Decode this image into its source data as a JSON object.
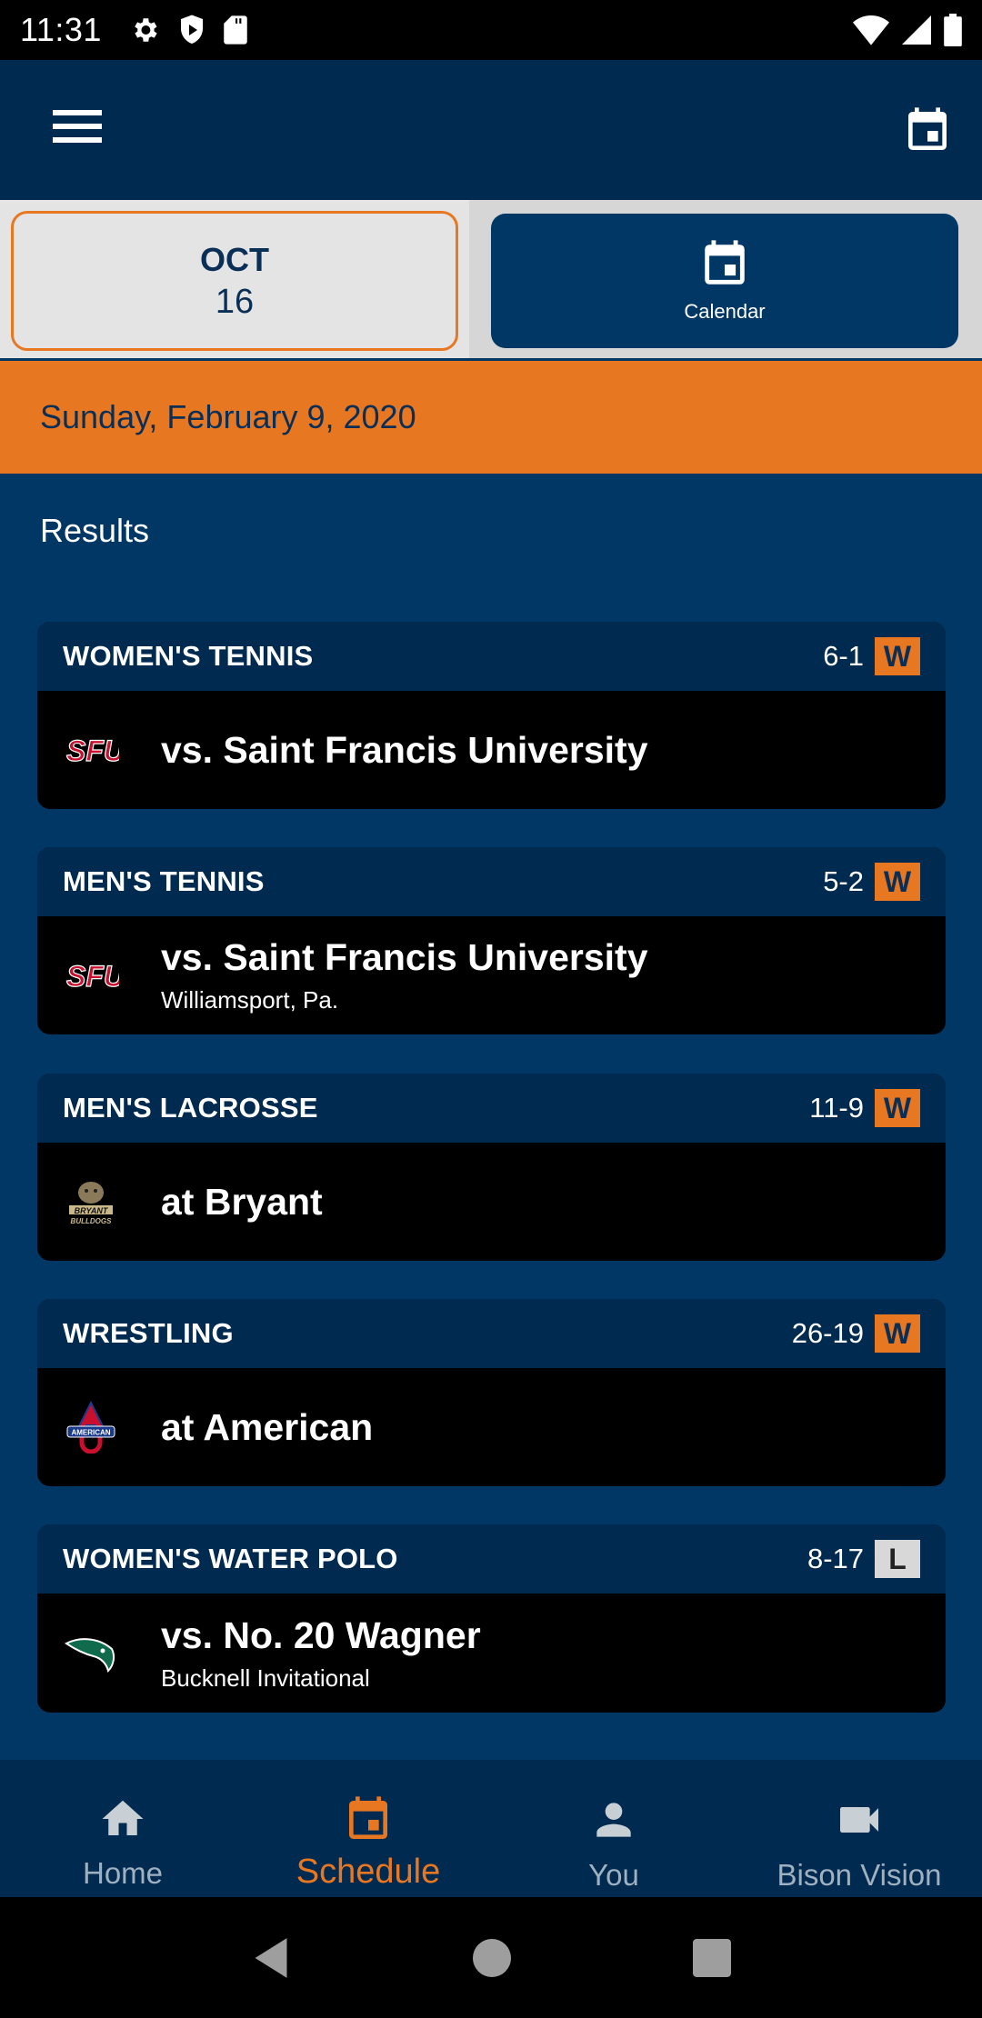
{
  "status_bar": {
    "time": "11:31",
    "left_icons": [
      "settings-icon",
      "shield-play-icon",
      "sd-card-icon"
    ],
    "right_icons": [
      "wifi-icon",
      "signal-icon",
      "battery-icon"
    ]
  },
  "app_bar": {
    "menu_icon": "hamburger-menu-icon",
    "action_icon": "calendar-icon"
  },
  "date_selector": {
    "month": "OCT",
    "day": "16",
    "calendar_button_label": "Calendar"
  },
  "banner": {
    "date": "Sunday, February 9, 2020"
  },
  "results": {
    "title": "Results",
    "games": [
      {
        "sport": "WOMEN'S TENNIS",
        "score": "6-1",
        "result": "W",
        "opponent": "vs. Saint Francis University",
        "location": "",
        "logo": "sfu-logo"
      },
      {
        "sport": "MEN'S TENNIS",
        "score": "5-2",
        "result": "W",
        "opponent": "vs. Saint Francis University",
        "location": "Williamsport, Pa.",
        "logo": "sfu-logo"
      },
      {
        "sport": "MEN'S LACROSSE",
        "score": "11-9",
        "result": "W",
        "opponent": "at Bryant",
        "location": "",
        "logo": "bryant-bulldogs-logo"
      },
      {
        "sport": "WRESTLING",
        "score": "26-19",
        "result": "W",
        "opponent": "at American",
        "location": "",
        "logo": "american-university-logo"
      },
      {
        "sport": "WOMEN'S WATER POLO",
        "score": "8-17",
        "result": "L",
        "opponent": "vs. No. 20 Wagner",
        "location": "Bucknell Invitational",
        "logo": "wagner-seahawks-logo"
      }
    ]
  },
  "bottom_nav": {
    "items": [
      {
        "label": "Home",
        "icon": "home-icon"
      },
      {
        "label": "Schedule",
        "icon": "calendar-icon",
        "active": true
      },
      {
        "label": "You",
        "icon": "person-icon"
      },
      {
        "label": "Bison Vision",
        "icon": "video-camera-icon"
      }
    ]
  },
  "colors": {
    "primary_navy": "#003764",
    "dark_navy": "#002a4f",
    "accent_orange": "#e87722",
    "loss_badge": "#d8d8d8"
  }
}
